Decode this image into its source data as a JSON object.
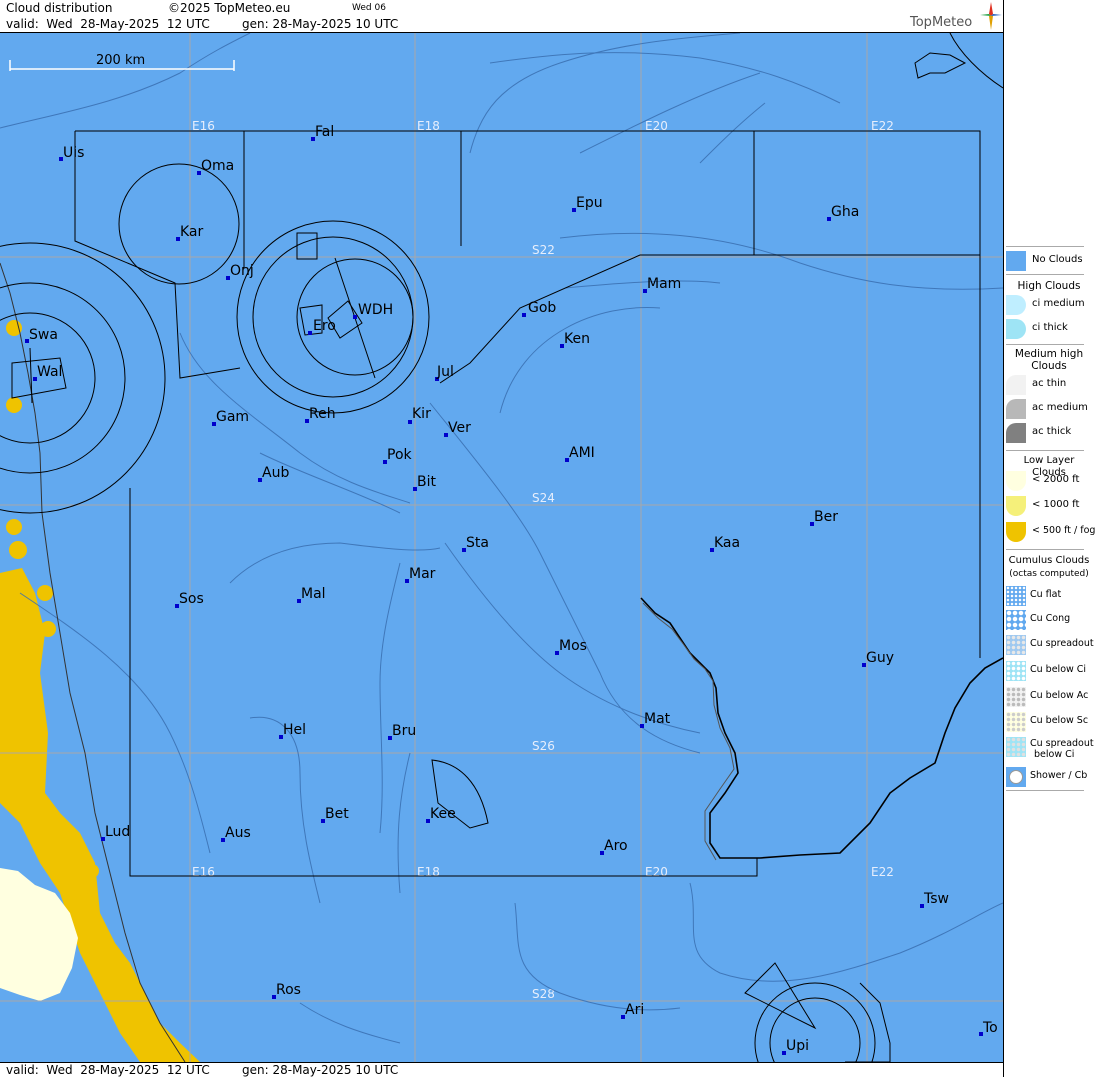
{
  "header": {
    "title": "Cloud distribution",
    "copyright": "©2025 TopMeteo.eu",
    "forecast_label": "Wed 06",
    "valid_line": "valid:  Wed  28-May-2025  12 UTC",
    "gen_line": "gen: 28-May-2025 10 UTC",
    "brand": "TopMeteo"
  },
  "footer": {
    "valid_line": "valid:  Wed  28-May-2025  12 UTC",
    "gen_line": "gen: 28-May-2025 10 UTC"
  },
  "scale": {
    "label": "200 km"
  },
  "colors": {
    "no_clouds": "#62a9ef",
    "low_2000": "#ffffe0",
    "low_1000": "#f5f07a",
    "low_500": "#efc300",
    "grid": "#a8a8a8",
    "border": "#000000",
    "city_dot": "#0000cc"
  },
  "grid_labels": {
    "lon": [
      "E16",
      "E18",
      "E20",
      "E22"
    ],
    "lat": [
      "S22",
      "S24",
      "S26",
      "S28"
    ]
  },
  "cities": [
    {
      "name": "Uis"
    },
    {
      "name": "Fal"
    },
    {
      "name": "Oma"
    },
    {
      "name": "Kar"
    },
    {
      "name": "Epu"
    },
    {
      "name": "Gha"
    },
    {
      "name": "Onj"
    },
    {
      "name": "Mam"
    },
    {
      "name": "Swa"
    },
    {
      "name": "Gob"
    },
    {
      "name": "WDH"
    },
    {
      "name": "Ero"
    },
    {
      "name": "Ken"
    },
    {
      "name": "Wal"
    },
    {
      "name": "Jul"
    },
    {
      "name": "Gam"
    },
    {
      "name": "Reh"
    },
    {
      "name": "Kir"
    },
    {
      "name": "Ver"
    },
    {
      "name": "Pok"
    },
    {
      "name": "AMI"
    },
    {
      "name": "Aub"
    },
    {
      "name": "Bit"
    },
    {
      "name": "Ber"
    },
    {
      "name": "Sta"
    },
    {
      "name": "Kaa"
    },
    {
      "name": "Mar"
    },
    {
      "name": "Sos"
    },
    {
      "name": "Mal"
    },
    {
      "name": "Mos"
    },
    {
      "name": "Guy"
    },
    {
      "name": "Mat"
    },
    {
      "name": "Hel"
    },
    {
      "name": "Bru"
    },
    {
      "name": "Bet"
    },
    {
      "name": "Kee"
    },
    {
      "name": "Lud"
    },
    {
      "name": "Aus"
    },
    {
      "name": "Aro"
    },
    {
      "name": "Tsw"
    },
    {
      "name": "Ros"
    },
    {
      "name": "Ari"
    },
    {
      "name": "To"
    },
    {
      "name": "Upi"
    }
  ],
  "legend": {
    "no_clouds": "No Clouds",
    "high_heading": "High Clouds",
    "ci_medium": "ci medium",
    "ci_thick": "ci thick",
    "medium_heading_1": "Medium high",
    "medium_heading_2": "Clouds",
    "ac_thin": "ac thin",
    "ac_medium": "ac medium",
    "ac_thick": "ac thick",
    "low_heading": "Low Layer Clouds",
    "low_2000": "< 2000 ft",
    "low_1000": "< 1000 ft",
    "low_500": "< 500 ft / fog",
    "cumulus_heading": "Cumulus Clouds",
    "cumulus_sub": "(octas computed)",
    "cu_flat": "Cu flat",
    "cu_cong": "Cu Cong",
    "cu_spreadout": "Cu spreadout",
    "cu_below_ci": "Cu below Ci",
    "cu_below_ac": "Cu below Ac",
    "cu_below_sc": "Cu below Sc",
    "cu_spreadout_below_ci_1": "Cu spreadout",
    "cu_spreadout_below_ci_2": "below Ci",
    "shower_cb": "Shower / Cb"
  }
}
